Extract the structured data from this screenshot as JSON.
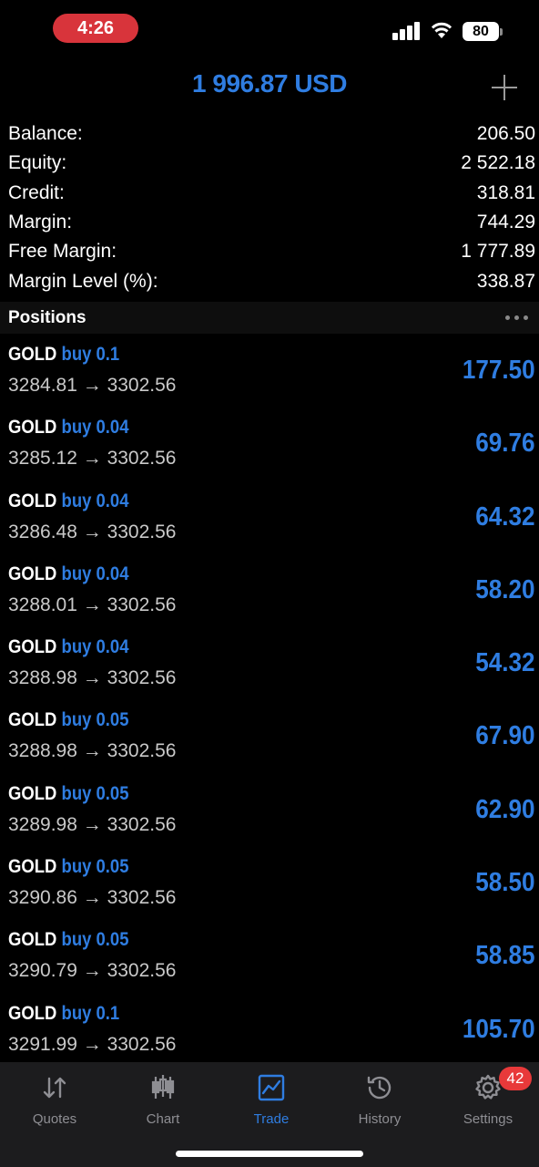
{
  "status": {
    "time": "4:26",
    "battery": "80"
  },
  "header": {
    "title": "1 996.87 USD"
  },
  "account": [
    {
      "label": "Balance:",
      "value": "206.50"
    },
    {
      "label": "Equity:",
      "value": "2 522.18"
    },
    {
      "label": "Credit:",
      "value": "318.81"
    },
    {
      "label": "Margin:",
      "value": "744.29"
    },
    {
      "label": "Free Margin:",
      "value": "1 777.89"
    },
    {
      "label": "Margin Level (%):",
      "value": "338.87"
    }
  ],
  "positions_header": "Positions",
  "positions": [
    {
      "symbol": "GOLD",
      "side": "buy 0.1",
      "prices": "3284.81 → 3302.56",
      "profit": "177.50"
    },
    {
      "symbol": "GOLD",
      "side": "buy 0.04",
      "prices": "3285.12 → 3302.56",
      "profit": "69.76"
    },
    {
      "symbol": "GOLD",
      "side": "buy 0.04",
      "prices": "3286.48 → 3302.56",
      "profit": "64.32"
    },
    {
      "symbol": "GOLD",
      "side": "buy 0.04",
      "prices": "3288.01 → 3302.56",
      "profit": "58.20"
    },
    {
      "symbol": "GOLD",
      "side": "buy 0.04",
      "prices": "3288.98 → 3302.56",
      "profit": "54.32"
    },
    {
      "symbol": "GOLD",
      "side": "buy 0.05",
      "prices": "3288.98 → 3302.56",
      "profit": "67.90"
    },
    {
      "symbol": "GOLD",
      "side": "buy 0.05",
      "prices": "3289.98 → 3302.56",
      "profit": "62.90"
    },
    {
      "symbol": "GOLD",
      "side": "buy 0.05",
      "prices": "3290.86 → 3302.56",
      "profit": "58.50"
    },
    {
      "symbol": "GOLD",
      "side": "buy 0.05",
      "prices": "3290.79 → 3302.56",
      "profit": "58.85"
    },
    {
      "symbol": "GOLD",
      "side": "buy 0.1",
      "prices": "3291.99 → 3302.56",
      "profit": "105.70"
    }
  ],
  "tabs": [
    {
      "label": "Quotes",
      "icon": "quotes-arrows-icon"
    },
    {
      "label": "Chart",
      "icon": "candlestick-icon"
    },
    {
      "label": "Trade",
      "icon": "trade-chart-icon",
      "active": true
    },
    {
      "label": "History",
      "icon": "history-clock-icon"
    },
    {
      "label": "Settings",
      "icon": "gear-icon"
    }
  ],
  "settings_badge": "42",
  "colors": {
    "accent": "#2f7de1",
    "background": "#000000",
    "badge": "#e8393a",
    "time_pill": "#d8343b"
  }
}
